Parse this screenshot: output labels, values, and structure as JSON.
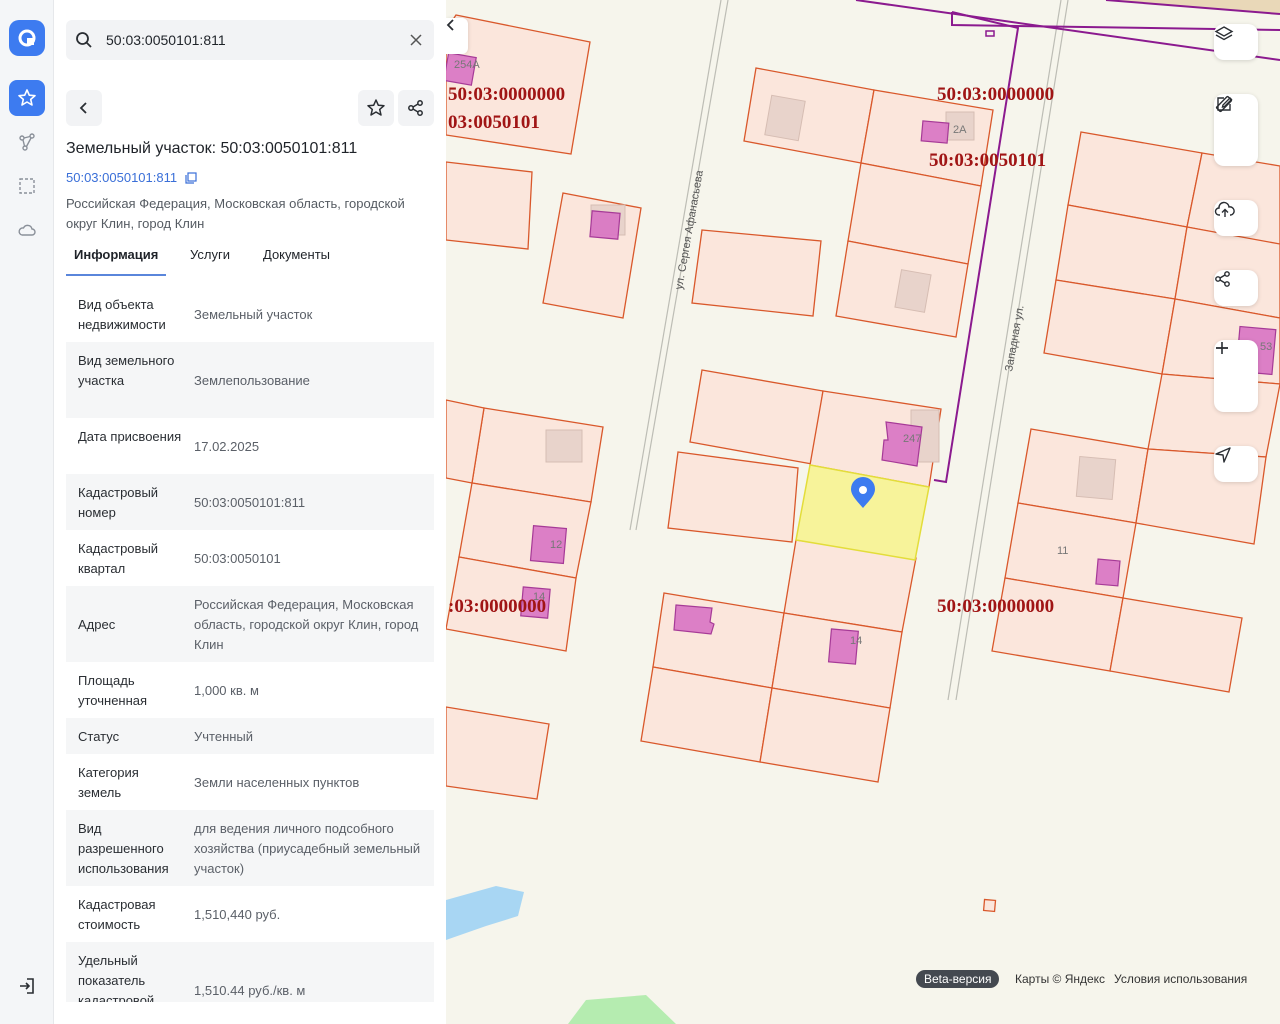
{
  "search": {
    "value": "50:03:0050101:811"
  },
  "header": {
    "title": "Земельный участок: 50:03:0050101:811",
    "cad_link": "50:03:0050101:811",
    "address": "Российская Федерация, Московская область, городской округ Клин, город Клин"
  },
  "tabs": [
    "Информация",
    "Услуги",
    "Документы"
  ],
  "rows": [
    {
      "k": "Вид объекта недвижимости",
      "v": "Земельный участок"
    },
    {
      "k": "Вид земельного участка",
      "v": "Землепользование"
    },
    {
      "k": "Дата присвоения",
      "v": "17.02.2025"
    },
    {
      "k": "Кадастровый номер",
      "v": "50:03:0050101:811"
    },
    {
      "k": "Кадастровый квартал",
      "v": "50:03:0050101"
    },
    {
      "k": "Адрес",
      "v": "Российская Федерация, Московская область, городской округ Клин, город Клин"
    },
    {
      "k": "Площадь уточненная",
      "v": "1,000 кв. м"
    },
    {
      "k": "Статус",
      "v": "Учтенный"
    },
    {
      "k": "Категория земель",
      "v": "Земли населенных пунктов"
    },
    {
      "k": "Вид разрешенного использования",
      "v": "для ведения личного подсобного хозяйства (приусадебный земельный участок)"
    },
    {
      "k": "Кадастровая стоимость",
      "v": "1,510,440 руб."
    },
    {
      "k": "Удельный показатель кадастровой",
      "v": "1,510.44 руб./кв. м"
    }
  ],
  "map": {
    "labels": {
      "q1": "50:03:0000000",
      "q2": "50:03:0050101",
      "q3": "50:03:0000000",
      "q4": "50:03:0050101",
      "q5": ":03:0000000",
      "q6": "50:03:0000000",
      "q6b": "03:0050101"
    },
    "streets": {
      "s1": "ул. Сергея Афанасьева",
      "s2": "Западная ул."
    },
    "house_numbers": {
      "h1": "2А",
      "h2": "247",
      "h3": "12",
      "h4": "14",
      "h5": "11",
      "h6": "14",
      "h7": "53",
      "h8": "254А"
    },
    "beta": "Beta-версия",
    "attribution": "Карты © Яндекс",
    "terms": "Условия использования"
  },
  "colors": {
    "accent": "#3a6fd8",
    "parcel_stroke": "#d9582b",
    "parcel_fill": "#fbe6dc",
    "selected_fill": "#f7f39a",
    "building": "#d873c3",
    "boundary": "#8b1a8f",
    "label": "#a01515"
  }
}
